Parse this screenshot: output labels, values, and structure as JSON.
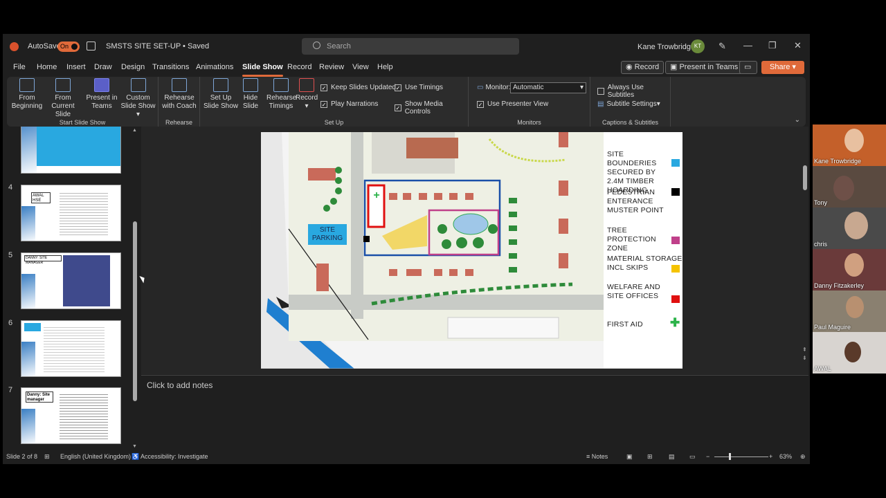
{
  "app": {
    "autosave_label": "AutoSave",
    "autosave_state": "On",
    "doc_title": "SMSTS SITE SET-UP • Saved",
    "search_placeholder": "Search",
    "user_name": "Kane Trowbridge",
    "user_initials": "KT"
  },
  "menu": [
    "File",
    "Home",
    "Insert",
    "Draw",
    "Design",
    "Transitions",
    "Animations",
    "Slide Show",
    "Record",
    "Review",
    "View",
    "Help"
  ],
  "menu_active": "Slide Show",
  "top_buttons": {
    "record": "Record",
    "present_teams": "Present in Teams",
    "share": "Share"
  },
  "ribbon": {
    "start": {
      "from_beginning": "From Beginning",
      "from_current": "From Current Slide",
      "present_teams": "Present in Teams",
      "custom": "Custom Slide Show",
      "label": "Start Slide Show"
    },
    "rehearse": {
      "coach": "Rehearse with Coach",
      "label": "Rehearse"
    },
    "setup": {
      "setup_show": "Set Up Slide Show",
      "hide": "Hide Slide",
      "timings": "Rehearse Timings",
      "record": "Record",
      "keep_updated": "Keep Slides Updated",
      "play_narr": "Play Narrations",
      "use_timings": "Use Timings",
      "show_media": "Show Media Controls",
      "label": "Set Up"
    },
    "monitors": {
      "monitor_label": "Monitor:",
      "monitor_value": "Automatic",
      "presenter_view": "Use Presenter View",
      "label": "Monitors"
    },
    "captions": {
      "always_subtitles": "Always Use Subtitles",
      "subtitle_settings": "Subtitle Settings",
      "label": "Captions & Subtitles"
    }
  },
  "thumbnails": [
    {
      "num": "4",
      "title": "AWAL HSE"
    },
    {
      "num": "5",
      "title": "DANNY: SITE MANAGER"
    },
    {
      "num": "6",
      "title": ""
    },
    {
      "num": "7",
      "title": "Danny: Site manager"
    }
  ],
  "slide": {
    "parking": "SITE PARKING",
    "legend": [
      {
        "text": "SITE BOUNDERIES SECURED BY 2.4M TIMBER HOARDING",
        "color": "#29a8e0"
      },
      {
        "text": "PEDESTRIAN ENTERANCE MUSTER POINT",
        "color": "#000000"
      },
      {
        "text": "TREE PROTECTION ZONE",
        "color": "#c0408a"
      },
      {
        "text": "MATERIAL STORAGE INCL SKIPS",
        "color": "#f5c300"
      },
      {
        "text": "WELFARE AND SITE OFFICES",
        "color": "#e01010"
      },
      {
        "text": "FIRST AID",
        "color": "#2cb34a"
      }
    ]
  },
  "notes_placeholder": "Click to add notes",
  "status": {
    "slide": "Slide 2 of 8",
    "language": "English (United Kingdom)",
    "accessibility": "Accessibility: Investigate",
    "notes": "Notes",
    "zoom": "63%"
  },
  "participants": [
    {
      "name": "Kane Trowbridge"
    },
    {
      "name": "Tony"
    },
    {
      "name": "chris"
    },
    {
      "name": "Danny Fitzakerley"
    },
    {
      "name": "Paul Maguire"
    },
    {
      "name": "AWAL"
    }
  ]
}
